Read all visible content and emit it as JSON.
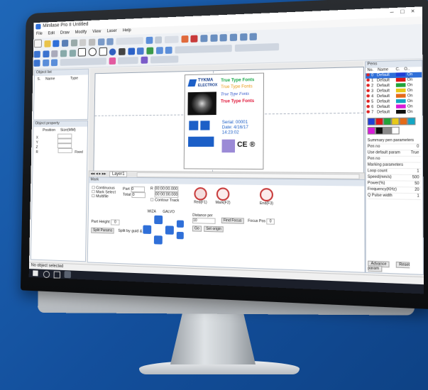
{
  "app": {
    "title": "Minilase Pro II Untitled",
    "menu": [
      "File",
      "Edit",
      "Draw",
      "Modify",
      "View",
      "Laser",
      "Help"
    ]
  },
  "object_list": {
    "title": "Object list",
    "col_no": "S.",
    "col_name": "Name",
    "col_type": "Type"
  },
  "object_property": {
    "title": "Object property",
    "position_label": "Position",
    "size_label": "Size(MM)",
    "axes": [
      "X",
      "Y",
      "Z",
      "R"
    ],
    "fixed": "Fixed"
  },
  "canvas": {
    "layer_tab": "Layer1",
    "label": {
      "brand_line1": "TYKMA",
      "brand_line2": "ELECTROX",
      "font_lines": [
        "True Type Fonts",
        "True Type Fonts",
        "True Type Fonts",
        "True Type Fonts"
      ],
      "font_colors": [
        "#18a84a",
        "#e89a18",
        "#2a4fc8",
        "#e0183a"
      ],
      "serial": "Serial: 00001",
      "date": "Date: 4/16/17",
      "time": "14:23:02",
      "marks": [
        "CE",
        "®"
      ]
    }
  },
  "pens": {
    "title": "Pens",
    "col_no": "No.",
    "col_name": "Name",
    "col_c": "C.",
    "col_on": "O..",
    "rows": [
      {
        "no": "0",
        "name": "Default",
        "color": "#1f3fd6",
        "on": "On",
        "selected": true
      },
      {
        "no": "1",
        "name": "Default",
        "color": "#e01818",
        "on": "On"
      },
      {
        "no": "2",
        "name": "Default",
        "color": "#22a33a",
        "on": "On"
      },
      {
        "no": "3",
        "name": "Default",
        "color": "#e8c818",
        "on": "On"
      },
      {
        "no": "4",
        "name": "Default",
        "color": "#e46a18",
        "on": "On"
      },
      {
        "no": "5",
        "name": "Default",
        "color": "#14a7c4",
        "on": "On"
      },
      {
        "no": "6",
        "name": "Default",
        "color": "#d81ad8",
        "on": "On"
      },
      {
        "no": "7",
        "name": "Default",
        "color": "#0f0f0f",
        "on": "On"
      }
    ],
    "palette": [
      "#1f3fd6",
      "#e01818",
      "#22a33a",
      "#e8c818",
      "#e46a18",
      "#14a7c4",
      "#d81ad8",
      "#0f0f0f",
      "#8a8a8a",
      "#ffffff"
    ],
    "props": [
      "Summary pen parameters",
      "Pen no",
      "Use default param",
      "Pen no",
      "Marking parameters",
      "Loop count",
      "Speed(mm/s)",
      "Power(%)",
      "Frequency(KHz)",
      "Q Pulse width"
    ],
    "prop_values": [
      "",
      "0",
      "True",
      "",
      "",
      "1",
      "500",
      "50",
      "20",
      "1"
    ],
    "advance_btn": "Advance",
    "reset_btn": "Reset param"
  },
  "mark": {
    "title": "Mark",
    "continuous": "Continuous",
    "mark_select": "Mark Select",
    "multifile": "Multifile",
    "part_label": "Part",
    "total_label": "Total",
    "part_value": "0",
    "total_value": "0",
    "r_label": "R",
    "time1": "00:00:00.000",
    "time2": "00:00:00.000",
    "contour_track": "Contour Track",
    "red_btn": "Red(F1)",
    "mark_btn": "Mark(F2)",
    "end_btn": "End(F3)",
    "part_height_label": "Part Height",
    "part_height_value": "0",
    "wizard": "WIZA",
    "galvo": "GALVO",
    "distance_label": "Distance per",
    "distance_value": "10",
    "find_focus": "Find Focus",
    "focus_pos": "Focus Pos",
    "focus_value": "0",
    "go_btn": "Go",
    "set_origin": "Set origin",
    "split_params": "Split Params",
    "split_guide": "Split by guid &"
  },
  "status": {
    "text": "No object selected"
  }
}
